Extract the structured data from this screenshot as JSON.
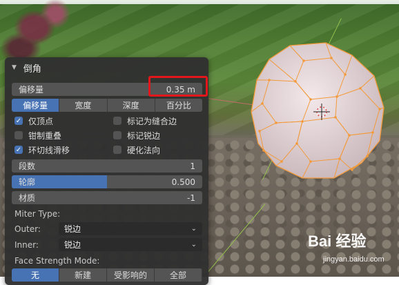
{
  "operator_panel": {
    "title": "倒角",
    "offset": {
      "label": "偏移量",
      "value": "0.35 m"
    },
    "width_type_tabs": [
      {
        "label": "偏移量",
        "active": true
      },
      {
        "label": "宽度",
        "active": false
      },
      {
        "label": "深度",
        "active": false
      },
      {
        "label": "百分比",
        "active": false
      }
    ],
    "options_left": [
      {
        "label": "仅顶点",
        "checked": true
      },
      {
        "label": "钳制重叠",
        "checked": false
      },
      {
        "label": "环切线滑移",
        "checked": true
      }
    ],
    "options_right": [
      {
        "label": "标记为缝合边",
        "checked": false
      },
      {
        "label": "标记锐边",
        "checked": false
      },
      {
        "label": "硬化法向",
        "checked": false
      }
    ],
    "segments": {
      "label": "段数",
      "value": "1"
    },
    "profile": {
      "label": "轮廓",
      "value": "0.500",
      "fill": 0.5
    },
    "material": {
      "label": "材质",
      "value": "-1"
    },
    "miter_type_label": "Miter Type:",
    "outer": {
      "label": "Outer:",
      "value": "锐边"
    },
    "inner": {
      "label": "Inner:",
      "value": "锐边"
    },
    "face_strength_label": "Face Strength Mode:",
    "face_strength_options": [
      {
        "label": "无",
        "active": true
      },
      {
        "label": "新建",
        "active": false
      },
      {
        "label": "受影响的",
        "active": false
      },
      {
        "label": "全部",
        "active": false
      }
    ]
  },
  "watermark": {
    "brand": "Bai 经验",
    "url": "jingyan.baidu.com"
  },
  "colors": {
    "accent": "#4772b3",
    "highlight": "#e3161b",
    "panel": "#303030",
    "mesh_vertex": "#f0922e"
  }
}
